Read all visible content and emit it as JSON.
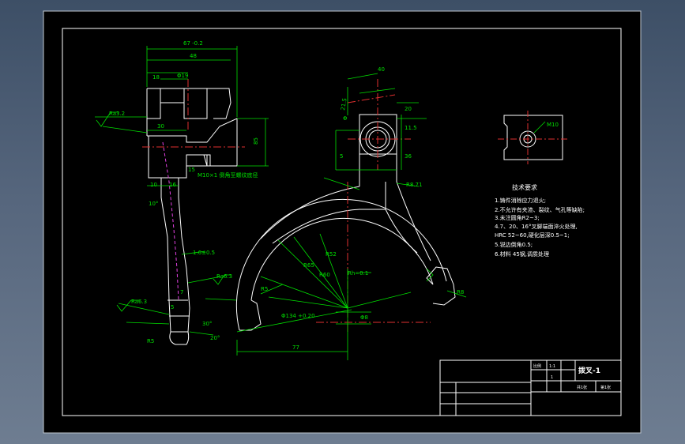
{
  "palette": {
    "viewport_bg": "#3d4f66",
    "paper": "#000000",
    "outline": "#ffffff",
    "dimension": "#00e000",
    "centerline": "#e03030",
    "hatch_hidden": "#e040e0"
  },
  "side_view": {
    "dim_top": "67 -0.2",
    "dim_48": "48",
    "dim_18": "18",
    "dim_phi": "Φ19",
    "roughness_left": "Ra3.2",
    "dim_30": "30",
    "dim_85": "85",
    "thread_note": "M10×1 倒角至螺纹底径",
    "dim_15": "15",
    "dim_10": "10",
    "dim_16": "16",
    "angle_10": "10°",
    "dim_165": "1.6±0.5",
    "roughness_mid": "Ra6.3",
    "dim_7": "7",
    "roughness_low": "Ra6.3",
    "dim_5": "5",
    "dim_r5": "R5",
    "angle_30": "30°",
    "angle_20": "20°"
  },
  "front_view": {
    "dim_40": "40",
    "dim_215": "21.5",
    "dim_20": "20",
    "dim_115": "11.5",
    "dim_phi_hole": "Φ",
    "dim_5": "5",
    "dim_36": "36",
    "dim_r": "R8.71",
    "dim_r65": "R65",
    "dim_r60": "R60",
    "dim_r52": "R52",
    "dim_77": "77",
    "dim_r5": "R5",
    "dim_phi_arc": "Φ134 +0.20",
    "dim_rh": "R8",
    "dim_phi_bottom": "Φ8",
    "centerline_label": "Rh=0.1"
  },
  "detail_view": {
    "hole_label": "M10"
  },
  "notes": {
    "title": "技术要求",
    "lines": [
      "1.铸件消除应力退火;",
      "2.不允许有夹渣、裂纹、气孔等缺陷;",
      "3.未注圆角R2~3;",
      "4.7、20、16°叉脚端面淬火处理,",
      "HRC 52~60,硬化层深0.5~1;",
      "5.锐边倒角0.5;",
      "6.材料 45钢,调质处理"
    ]
  },
  "title_block": {
    "part_name": "拨叉-1",
    "scale_label": "比例",
    "scale_value": "1:1",
    "qty_value": "1",
    "sheet_a": "共1张",
    "sheet_b": "第1张"
  }
}
